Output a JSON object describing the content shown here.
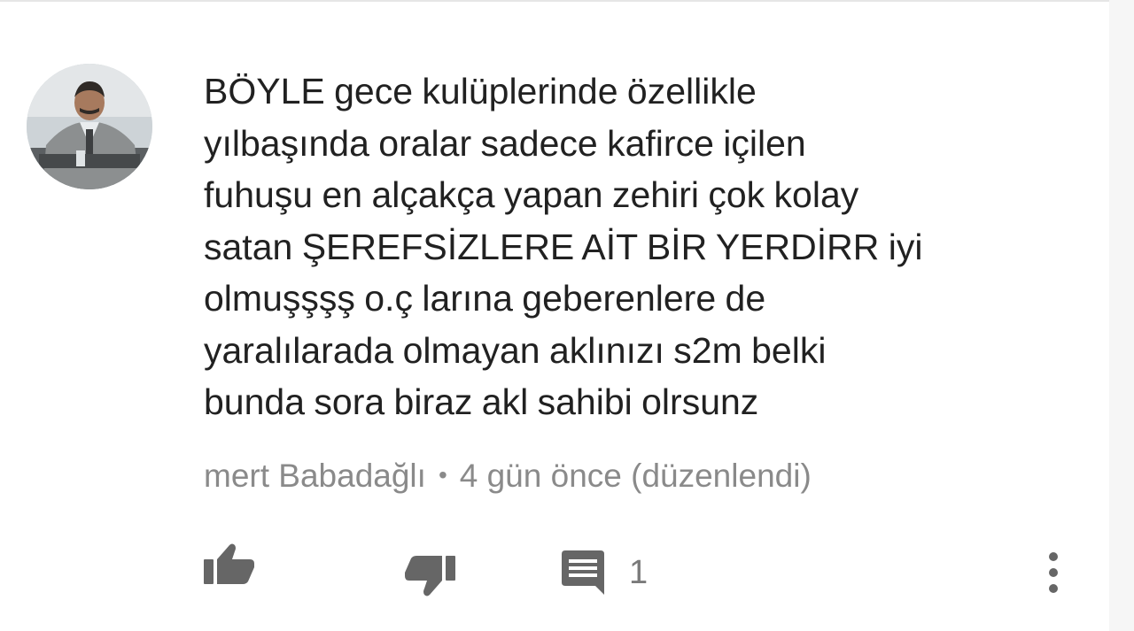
{
  "comment": {
    "text": "BÖYLE gece kulüplerinde özellikle\nyılbaşında  oralar sadece kafirce içilen\nfuhuşu en alçakça yapan zehiri  çok kolay\nsatan ŞEREFSİZLERE AİT BİR YERDİRR   iyi\nolmuşşşş o.ç larına geberenlere de\nyaralılarada  olmayan aklınızı s2m belki\nbunda sora biraz akl sahibi olrsunz",
    "author": "mert Babadağlı",
    "separator": "•",
    "time": "4 gün önce (düzenlendi)",
    "reply_count": "1"
  },
  "icons": {
    "avatar": "avatar",
    "like": "thumb-up-icon",
    "dislike": "thumb-down-icon",
    "reply": "comment-icon",
    "more": "more-vert-icon"
  },
  "colors": {
    "text": "#212121",
    "meta": "#8a8a8a",
    "icon": "#666666"
  }
}
